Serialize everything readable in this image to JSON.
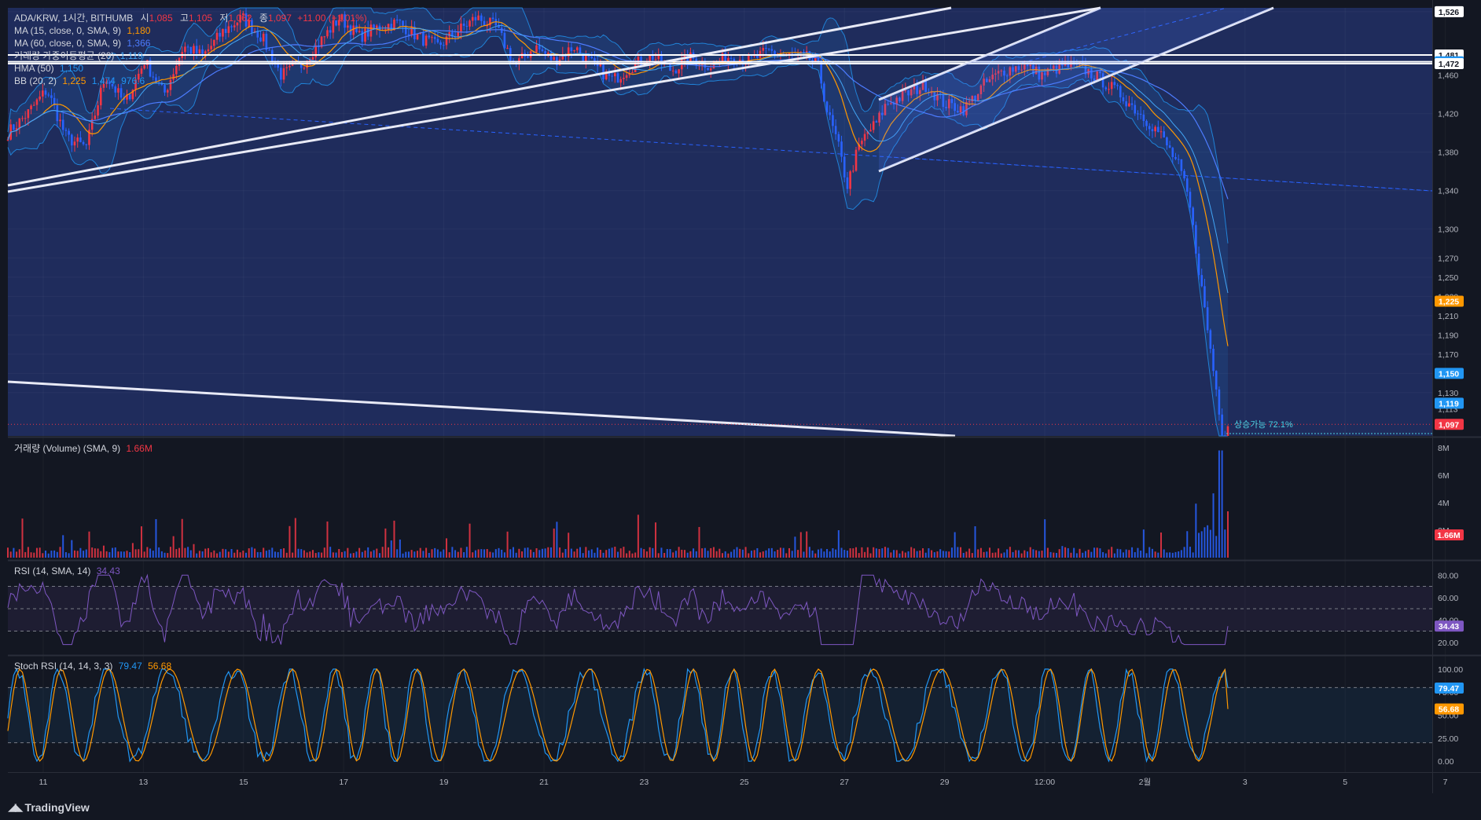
{
  "symbol_legend": {
    "title": "ADA/KRW, 1시간, BITHUMB",
    "o_label": "시",
    "o": "1,085",
    "h_label": "고",
    "h": "1,105",
    "l_label": "저",
    "l": "1,062",
    "c_label": "종",
    "c": "1,097",
    "chg": "+11.00 (+1.01%)"
  },
  "indicators": [
    {
      "name": "MA (15, close, 0, SMA, 9)",
      "value": "1,180",
      "color": "#ff9800"
    },
    {
      "name": "MA (60, close, 0, SMA, 9)",
      "value": "1,366",
      "color": "#2962ff"
    },
    {
      "name": "거래량 가중이동평균 (20)",
      "value": "1,119",
      "color": "#42a5f5"
    },
    {
      "name": "HMA (50)",
      "value": "1,150",
      "color": "#2196f3"
    },
    {
      "name": "BB (20, 2)",
      "values": [
        "1,225",
        "1,474",
        "976.6"
      ],
      "colors": [
        "#ff9800",
        "#2196f3",
        "#2196f3"
      ]
    }
  ],
  "price_axis": {
    "ticks": [
      "1,526",
      "1,481",
      "1,474",
      "1,472",
      "1,460",
      "1,420",
      "1,380",
      "1,340",
      "1,300",
      "1,270",
      "1,250",
      "1,230",
      "1,210",
      "1,190",
      "1,170",
      "1,150",
      "1,130",
      "1,119",
      "1,113",
      "1,097"
    ],
    "badges": [
      {
        "label": "1,526",
        "value": 1526,
        "bg": "#ffffff",
        "fg": "#131722"
      },
      {
        "label": "1,481",
        "value": 1481,
        "bg": "#ffffff",
        "fg": "#131722"
      },
      {
        "label": "1,474",
        "value": 1474,
        "bg": "#2196f3",
        "fg": "#ffffff"
      },
      {
        "label": "1,472",
        "value": 1472,
        "bg": "#ffffff",
        "fg": "#131722"
      },
      {
        "label": "1,225",
        "value": 1225,
        "bg": "#ff9800",
        "fg": "#ffffff"
      },
      {
        "label": "1,150",
        "value": 1150,
        "bg": "#2196f3",
        "fg": "#ffffff"
      },
      {
        "label": "1,119",
        "value": 1119,
        "bg": "#2196f3",
        "fg": "#ffffff"
      },
      {
        "label": "1,097",
        "value": 1097,
        "bg": "#f23645",
        "fg": "#ffffff"
      }
    ]
  },
  "annotation": "상승가능 72.1%",
  "volume_legend": {
    "name": "거래량 (Volume) (SMA, 9)",
    "value": "1.66M"
  },
  "volume_axis": {
    "ticks": [
      "8M",
      "6M",
      "4M",
      "2M"
    ],
    "badge": "1.66M"
  },
  "rsi_legend": {
    "name": "RSI (14, SMA, 14)",
    "value": "34.43"
  },
  "rsi_axis": {
    "ticks": [
      "80.00",
      "60.00",
      "40.00",
      "20.00"
    ],
    "badge": "34.43"
  },
  "stoch_legend": {
    "name": "Stoch RSI (14, 14, 3, 3)",
    "k": "79.47",
    "d": "56.68"
  },
  "stoch_axis": {
    "ticks": [
      "100.00",
      "75.00",
      "50.00",
      "25.00",
      "0.00"
    ],
    "badge_k": "79.47",
    "badge_d": "56.68"
  },
  "time_axis": [
    "11",
    "13",
    "15",
    "17",
    "19",
    "21",
    "23",
    "25",
    "27",
    "29",
    "12:00",
    "2월",
    "3",
    "5",
    "7"
  ],
  "brand": "TradingView",
  "chart_data": {
    "type": "candlestick",
    "symbol": "ADA/KRW",
    "interval": "1시간",
    "exchange": "BITHUMB",
    "last_ohlc": {
      "open": 1085,
      "high": 1105,
      "low": 1062,
      "close": 1097,
      "change": 11.0,
      "change_pct": 1.01
    },
    "x_ticks": [
      "11",
      "13",
      "15",
      "17",
      "19",
      "21",
      "23",
      "25",
      "27",
      "29",
      "12:00",
      "2월",
      "3",
      "5",
      "7"
    ],
    "price_range": [
      1085,
      1530
    ],
    "price_path_approx": [
      [
        0,
        1400
      ],
      [
        0.4,
        1420
      ],
      [
        0.8,
        1445
      ],
      [
        1.2,
        1395
      ],
      [
        1.6,
        1385
      ],
      [
        2.0,
        1460
      ],
      [
        2.4,
        1430
      ],
      [
        2.8,
        1475
      ],
      [
        3.2,
        1440
      ],
      [
        3.6,
        1490
      ],
      [
        4.0,
        1480
      ],
      [
        4.4,
        1505
      ],
      [
        4.8,
        1520
      ],
      [
        5.2,
        1500
      ],
      [
        5.6,
        1460
      ],
      [
        6.0,
        1470
      ],
      [
        6.4,
        1495
      ],
      [
        6.8,
        1520
      ],
      [
        7.2,
        1500
      ],
      [
        7.6,
        1510
      ],
      [
        8.0,
        1515
      ],
      [
        8.4,
        1500
      ],
      [
        8.8,
        1490
      ],
      [
        9.2,
        1505
      ],
      [
        9.6,
        1520
      ],
      [
        10.0,
        1510
      ],
      [
        10.4,
        1470
      ],
      [
        10.8,
        1490
      ],
      [
        11.2,
        1475
      ],
      [
        11.6,
        1490
      ],
      [
        12.0,
        1470
      ],
      [
        12.4,
        1455
      ],
      [
        12.8,
        1470
      ],
      [
        13.2,
        1480
      ],
      [
        13.6,
        1465
      ],
      [
        14.0,
        1478
      ],
      [
        14.4,
        1470
      ],
      [
        14.8,
        1480
      ],
      [
        15.2,
        1475
      ],
      [
        15.6,
        1485
      ],
      [
        16.0,
        1480
      ],
      [
        16.4,
        1478
      ],
      [
        16.6,
        1470
      ],
      [
        16.8,
        1420
      ],
      [
        17.0,
        1390
      ],
      [
        17.2,
        1345
      ],
      [
        17.4,
        1380
      ],
      [
        17.6,
        1400
      ],
      [
        17.8,
        1410
      ],
      [
        18.0,
        1430
      ],
      [
        18.4,
        1440
      ],
      [
        18.8,
        1450
      ],
      [
        19.2,
        1430
      ],
      [
        19.6,
        1425
      ],
      [
        20.0,
        1450
      ],
      [
        20.4,
        1465
      ],
      [
        20.8,
        1470
      ],
      [
        21.2,
        1460
      ],
      [
        21.6,
        1470
      ],
      [
        22.0,
        1468
      ],
      [
        22.4,
        1455
      ],
      [
        22.8,
        1440
      ],
      [
        23.2,
        1420
      ],
      [
        23.6,
        1400
      ],
      [
        24.0,
        1365
      ],
      [
        24.2,
        1330
      ],
      [
        24.4,
        1260
      ],
      [
        24.6,
        1190
      ],
      [
        24.8,
        1120
      ],
      [
        24.9,
        1085
      ],
      [
        25.0,
        1097
      ]
    ],
    "overlays": {
      "MA15": 1180,
      "MA60": 1366,
      "VWMA20": 1119,
      "HMA50": 1150,
      "BB": {
        "basis": 1225,
        "upper": 1474,
        "lower": 976.6
      }
    },
    "horizontal_levels": [
      1526,
      1481,
      1474,
      1472
    ],
    "volume": {
      "sma9": "1.66M",
      "range": [
        0,
        8000000
      ],
      "peak": 7800000
    },
    "rsi": {
      "last": 34.43,
      "levels": [
        70,
        50,
        30
      ],
      "range": [
        10,
        90
      ]
    },
    "stoch_rsi": {
      "k": 79.47,
      "d": 56.68,
      "levels": [
        80,
        20
      ],
      "range": [
        -5,
        105
      ]
    }
  }
}
